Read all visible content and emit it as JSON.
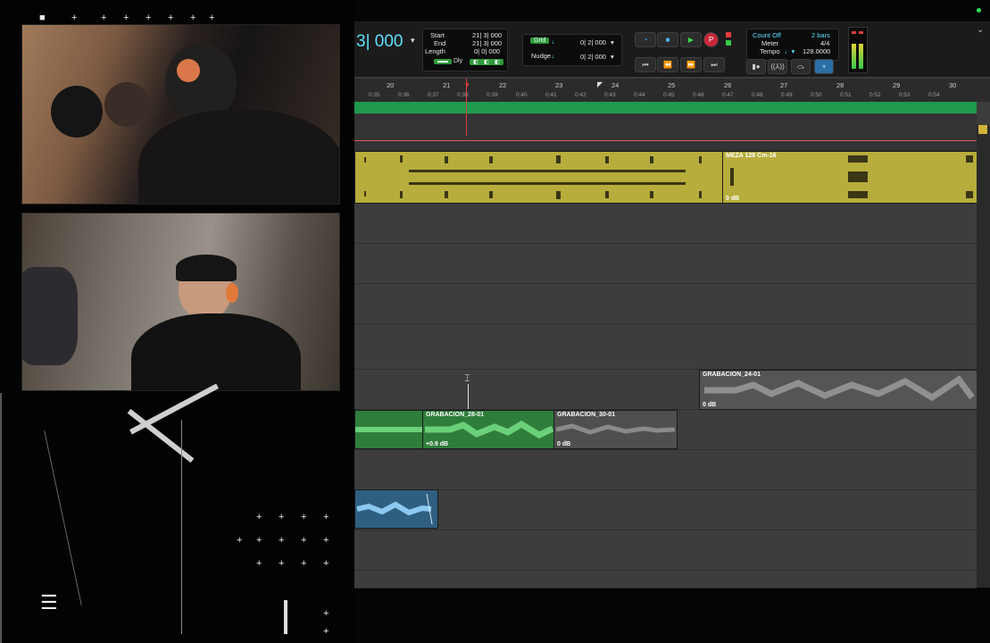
{
  "transport": {
    "counter": "3| 000",
    "start_label": "Start",
    "start_value": "21| 3| 000",
    "end_label": "End",
    "end_value": "21| 3| 000",
    "length_label": "Length",
    "length_value": "0| 0| 000",
    "dly_label": "Dly",
    "grid_label": "Grid",
    "grid_value": "0| 2| 000",
    "nudge_label": "Nudge",
    "nudge_value": "0| 2| 000",
    "count_off_label": "Count Off",
    "count_off_value": "2 bars",
    "meter_label": "Meter",
    "meter_value": "4/4",
    "tempo_label": "Tempo",
    "tempo_value": "128.0000",
    "record_button_label": "P"
  },
  "ruler": {
    "bars": [
      "20",
      "21",
      "22",
      "23",
      "24",
      "25",
      "26",
      "27",
      "28",
      "29",
      "30"
    ],
    "times": [
      "0:35",
      "0:36",
      "0:37",
      "0:38",
      "0:39",
      "0:40",
      "0:41",
      "0:42",
      "0:43",
      "0:44",
      "0:45",
      "0:46",
      "0:47",
      "0:48",
      "0:49",
      "0:50",
      "0:51",
      "0:52",
      "0:53",
      "0:54"
    ]
  },
  "clips": {
    "beat": {
      "name": "MEZA 128 Cm-16",
      "gain": "0 dB",
      "color": "#b7ad3c"
    },
    "grab24": {
      "name": "GRABACION_24-01",
      "gain": "0 dB",
      "color": "#5a5a5a"
    },
    "grab28": {
      "name": "GRABACION_28-01",
      "gain": "+0.9 dB",
      "color": "#2f7d3b"
    },
    "grab30": {
      "name": "GRABACION_30-01",
      "gain": "0 dB",
      "color": "#4f4f4f"
    },
    "blue": {
      "color": "#2f5f80"
    }
  },
  "overlay": {
    "menu_glyph": "☰"
  }
}
